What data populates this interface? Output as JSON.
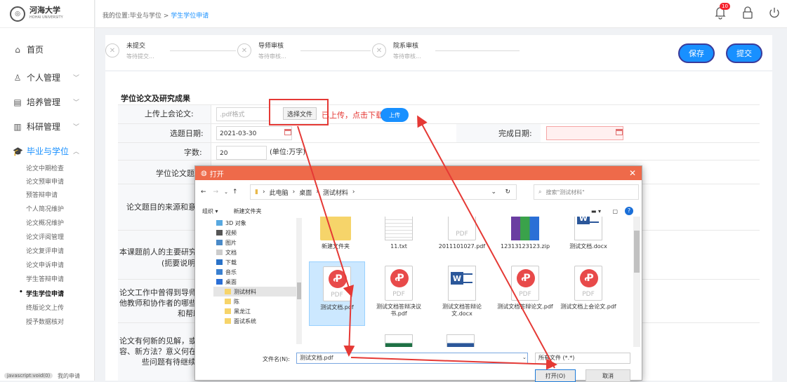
{
  "logo": {
    "name": "河海大学",
    "sub": "HOHAI UNIVERSITY"
  },
  "sidebar": {
    "home": "首页",
    "groups": [
      {
        "label": "个人管理"
      },
      {
        "label": "培养管理"
      },
      {
        "label": "科研管理"
      },
      {
        "label": "毕业与学位"
      }
    ],
    "sub_items": [
      "论文中期检查",
      "论文预审申请",
      "预答辩申请",
      "个人简况维护",
      "论文概况维护",
      "论文评阅管理",
      "论文复评申请",
      "论文申诉申请",
      "学生答辩申请",
      "学生学位申请",
      "终版论文上传",
      "授予数据核对"
    ],
    "footer_pill": "javascript:void(0)",
    "footer": "我的申请"
  },
  "topbar": {
    "breadcrumb_prefix": "我的位置:毕业与学位 > ",
    "breadcrumb_current": "学生学位申请",
    "notification_count": "10"
  },
  "steps": [
    {
      "title": "未提交",
      "sub": "等待提交..."
    },
    {
      "title": "导师审核",
      "sub": "等待审核..."
    },
    {
      "title": "院系审核",
      "sub": "等待审核..."
    }
  ],
  "actions": {
    "save": "保存",
    "submit": "提交"
  },
  "form": {
    "section_title": "学位论文及研究成果",
    "upload_label": "上传上会论文:",
    "upload_placeholder": ".pdf格式",
    "choose_file": "选择文件",
    "uploaded_text": "已上传，点击下载",
    "upload_btn": "上传",
    "start_label": "选题日期:",
    "start_value": "2021-03-30",
    "finish_label": "完成日期:",
    "words_label": "字数:",
    "words_value": "20",
    "words_unit": "(单位:万字)",
    "topic_label": "学位论文题目",
    "source_label": "论文题目的来源和意义",
    "prior_label": "本课题前人的主要研究成果",
    "prior_sub": "(扼要说明)",
    "help_label_1": "论文工作中曾得到导师、",
    "help_label_2": "他教师和协作者的哪些指",
    "help_label_3": "和帮助",
    "new_label_1": "论文有何新的见解，或是",
    "new_label_2": "容、新方法？意义何在？",
    "new_label_3": "些问题有待继续探"
  },
  "dialog": {
    "title": "打开",
    "path": [
      "此电脑",
      "桌面",
      "测试材料"
    ],
    "search_placeholder": "搜索\"测试材料\"",
    "organize": "组织 ▾",
    "new_folder": "新建文件夹",
    "tree": [
      "3D 对象",
      "视频",
      "图片",
      "文档",
      "下载",
      "音乐",
      "桌面",
      "测试材料",
      "陈",
      "黑龙江",
      "面试系统"
    ],
    "files": [
      {
        "name": "新建文件夹",
        "kind": "folder"
      },
      {
        "name": "11.txt",
        "kind": "txt"
      },
      {
        "name": "2011101027.pdf",
        "kind": "pdf"
      },
      {
        "name": "12313123123.zip",
        "kind": "zip"
      },
      {
        "name": "测试文档.docx",
        "kind": "doc"
      },
      {
        "name": "测试文档.pdf",
        "kind": "pdf"
      },
      {
        "name": "测试文档答辩决议书.pdf",
        "kind": "pdf"
      },
      {
        "name": "测试文档答辩论文.docx",
        "kind": "doc"
      },
      {
        "name": "测试文档答辩论文.pdf",
        "kind": "pdf"
      },
      {
        "name": "测试文档上会论文.pdf",
        "kind": "pdf"
      }
    ],
    "filename_label": "文件名(N):",
    "filename_value": "测试文档.pdf",
    "filetype": "所有文件 (*.*)",
    "open": "打开(O)",
    "cancel": "取消"
  }
}
